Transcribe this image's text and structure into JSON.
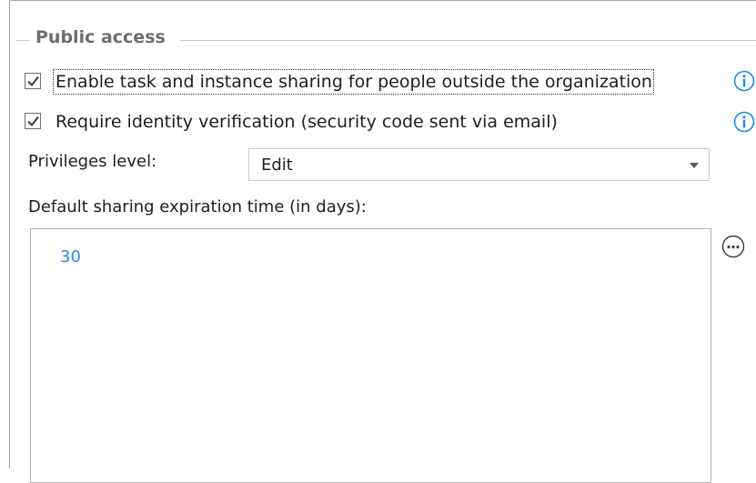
{
  "group": {
    "title": "Public access"
  },
  "options": {
    "enable_sharing": {
      "label": "Enable task and instance sharing for people outside the organization",
      "checked": true
    },
    "require_verification": {
      "label": "Require identity verification (security code sent via email)",
      "checked": true
    }
  },
  "privileges": {
    "label": "Privileges level:",
    "selected": "Edit"
  },
  "expiration": {
    "label": "Default sharing expiration time (in days):",
    "value": "30"
  },
  "icons": {
    "info": "info-icon",
    "more": "more-options-icon",
    "check": "checkmark-icon",
    "dropdown": "chevron-down-icon"
  },
  "colors": {
    "accent": "#1e88e5",
    "value_text": "#2e8be6",
    "group_title": "#6d6d6d"
  }
}
